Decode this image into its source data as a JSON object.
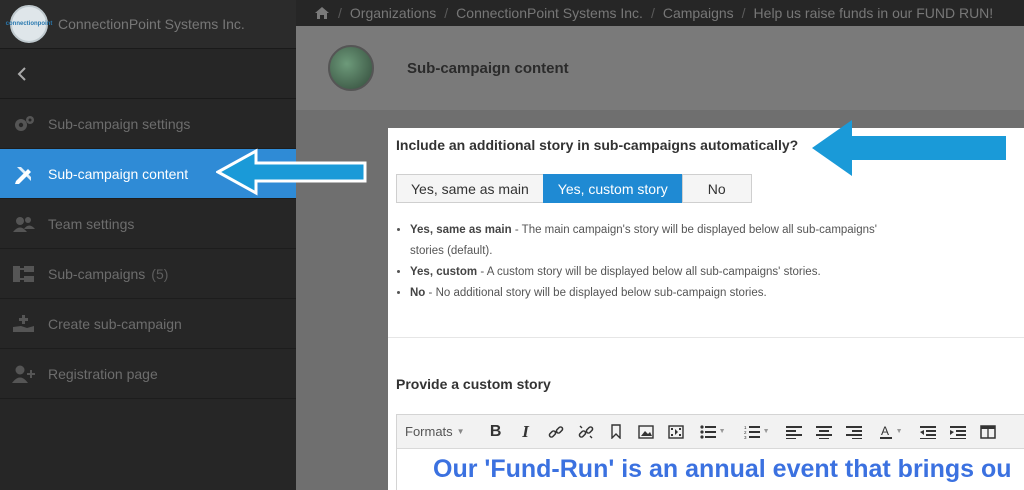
{
  "sidebar": {
    "org_logo_text": "connectionpoint",
    "org_name": "ConnectionPoint Systems Inc.",
    "collapse_icon": "chevron-left-icon",
    "items": [
      {
        "label": "Sub-campaign settings",
        "icon": "gears-icon"
      },
      {
        "label": "Sub-campaign content",
        "icon": "pencil-ruler-icon",
        "active": true
      },
      {
        "label": "Team settings",
        "icon": "users-icon"
      },
      {
        "label": "Sub-campaigns",
        "count": "(5)",
        "icon": "sitemap-icon"
      },
      {
        "label": "Create sub-campaign",
        "icon": "hand-plus-icon"
      },
      {
        "label": "Registration page",
        "icon": "user-plus-icon"
      }
    ]
  },
  "breadcrumb": {
    "home_icon": "home-icon",
    "items": [
      "Organizations",
      "ConnectionPoint Systems Inc.",
      "Campaigns",
      "Help us raise funds in our FUND RUN!"
    ],
    "separator": "/"
  },
  "header": {
    "title": "Sub-campaign content"
  },
  "content": {
    "question": "Include an additional story in sub-campaigns automatically?",
    "options": [
      {
        "label": "Yes, same as main",
        "active": false
      },
      {
        "label": "Yes, custom story",
        "active": true
      },
      {
        "label": "No",
        "active": false
      }
    ],
    "notes": [
      {
        "term": "Yes, same as main",
        "text": " - The main campaign's story will be displayed below all sub-campaigns' stories (default)."
      },
      {
        "term": "Yes, custom",
        "text": " - A custom story will be displayed below all sub-campaigns' stories."
      },
      {
        "term": "No",
        "text": " - No additional story will be displayed below sub-campaign stories."
      }
    ],
    "custom_story_label": "Provide a custom story"
  },
  "editor": {
    "formats_label": "Formats",
    "toolbar_icons": [
      "bold-icon",
      "italic-icon",
      "link-icon",
      "unlink-icon",
      "bookmark-icon",
      "image-icon",
      "media-icon",
      "bullet-list-icon",
      "numbered-list-icon",
      "align-left-icon",
      "align-center-icon",
      "align-right-icon",
      "font-color-icon",
      "outdent-icon",
      "indent-icon",
      "table-icon"
    ],
    "body_text": "Our 'Fund-Run' is an annual event that brings ou",
    "text_color": "#3b71e0"
  },
  "colors": {
    "accent": "#2f8bd6",
    "arrow": "#1a9ad8",
    "sidebar_bg": "#262626"
  }
}
